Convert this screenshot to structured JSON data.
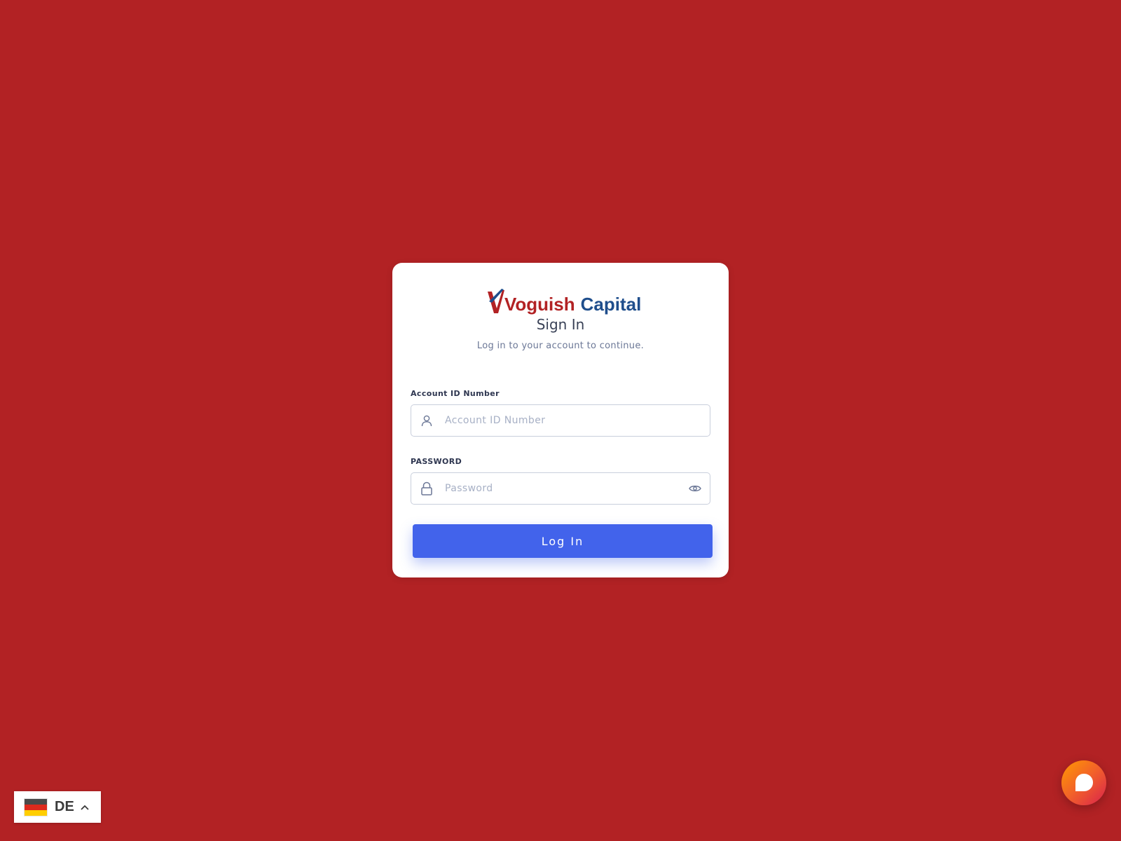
{
  "brand": {
    "logo_word_1": "Voguish",
    "logo_word_2": "Capital",
    "primary_color": "#b22224",
    "secondary_color": "#1f4e8c"
  },
  "signin": {
    "title": "Sign In",
    "subtitle": "Log in to your account to continue."
  },
  "form": {
    "account_label": "Account ID Number",
    "account_placeholder": "Account ID Number",
    "account_value": "",
    "password_label": "PASSWORD",
    "password_placeholder": "Password",
    "password_value": "",
    "login_label": "Log In",
    "button_color": "#4263eb"
  },
  "language": {
    "code": "DE",
    "flag": "germany-flag-icon"
  },
  "icons": {
    "account": "user-icon",
    "password": "lock-icon",
    "reveal": "eye-icon",
    "expand": "chevron-up-icon",
    "chat": "chat-bubble-icon"
  },
  "background_color": "#b22224"
}
